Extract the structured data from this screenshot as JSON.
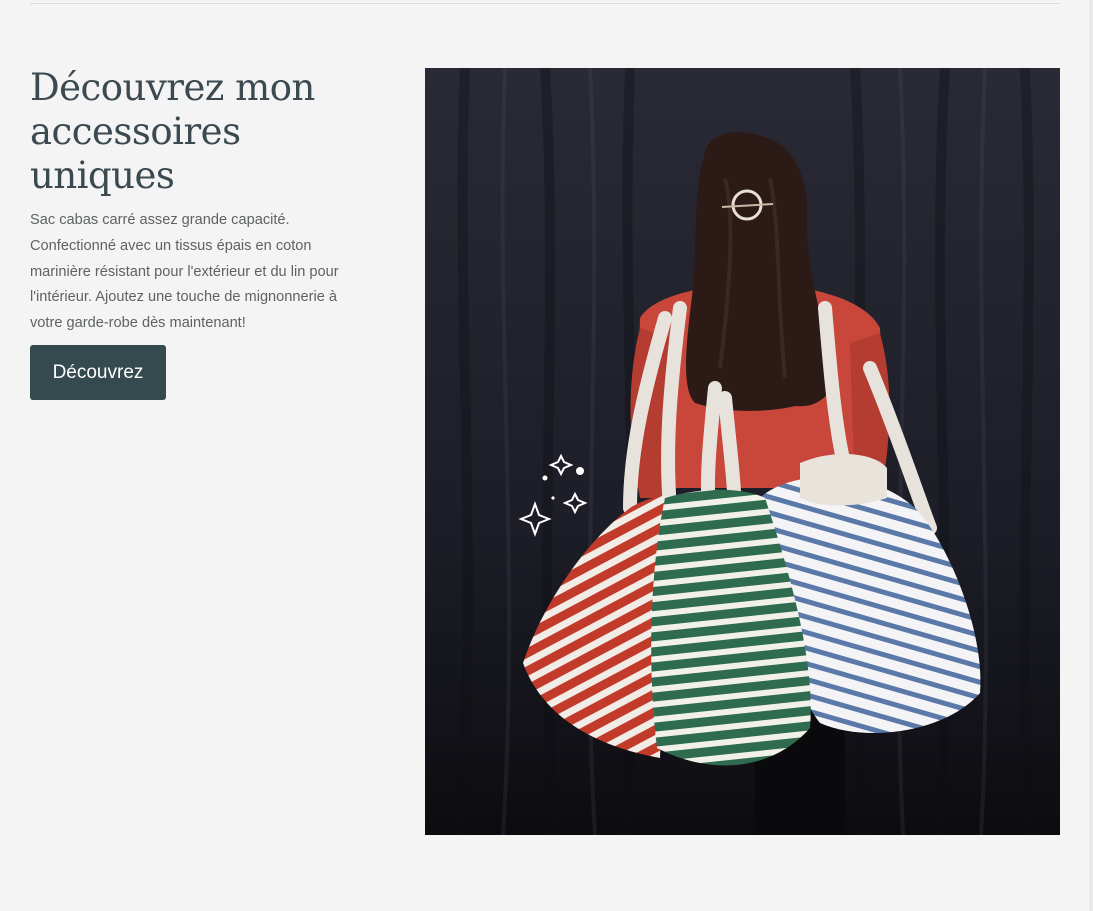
{
  "hero": {
    "title": "Découvrez mon accessoires uniques",
    "description": "Sac cabas carré assez grande capacité. Confectionné avec un tissus épais en coton marinière résistant pour l'extérieur et du lin pour l'intérieur. Ajoutez une touche de mignonnerie à votre garde-robe dès maintenant!",
    "cta_label": "Découvrez"
  },
  "photo": {
    "subject": "woman-carrying-striped-tote-bags",
    "bag_colors": [
      "#c23b2a",
      "#2f6b4f",
      "#5b79a8"
    ],
    "background_color": "#1e1e27"
  },
  "theme": {
    "page_bg": "#f4f4f4",
    "heading_color": "#3b4a50",
    "text_color": "#5e6264",
    "button_bg": "#354a4e",
    "button_text": "#ffffff"
  }
}
